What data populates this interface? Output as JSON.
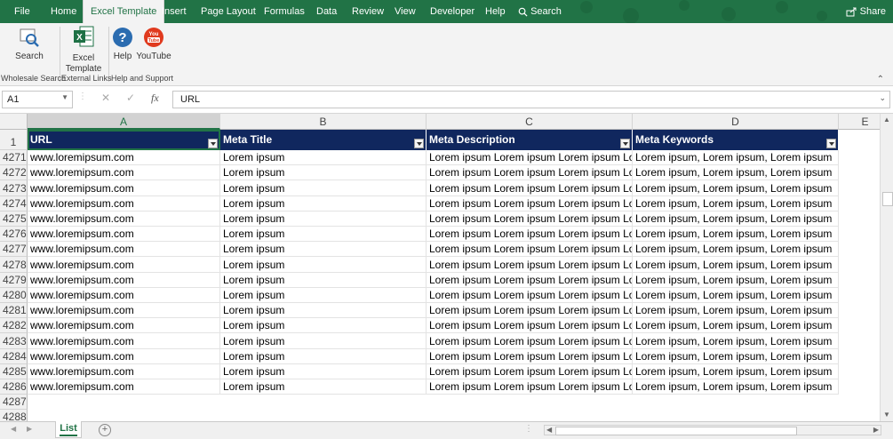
{
  "ribbon_tabs": [
    "File",
    "Home",
    "Excel Template",
    "Insert",
    "Page Layout",
    "Formulas",
    "Data",
    "Review",
    "View",
    "Developer",
    "Help"
  ],
  "tell_me": "Search",
  "share_label": "Share",
  "ribbon_buttons": {
    "search": "Search",
    "excel_template_line1": "Excel",
    "excel_template_line2": "Template",
    "help": "Help",
    "youtube": "YouTube"
  },
  "ribbon_groups": {
    "wholesale_search": "Wholesale Search",
    "external_links": "External Links",
    "help_support": "Help and Support"
  },
  "icons": {
    "youtube_line1": "You",
    "youtube_line2": "Tube"
  },
  "name_box": "A1",
  "formula_value": "URL",
  "columns": [
    "A",
    "B",
    "C",
    "D",
    "E"
  ],
  "header_row_number": "1",
  "table_headers": [
    "URL",
    "Meta Title",
    "Meta Description",
    "Meta Keywords"
  ],
  "rows": [
    {
      "num": "4271",
      "url": "www.loremipsum.com",
      "title": "Lorem ipsum",
      "desc": "Lorem ipsum Lorem ipsum Lorem ipsum Lo",
      "kw": "Lorem ipsum, Lorem ipsum, Lorem ipsum"
    },
    {
      "num": "4272",
      "url": "www.loremipsum.com",
      "title": "Lorem ipsum",
      "desc": "Lorem ipsum Lorem ipsum Lorem ipsum Lo",
      "kw": "Lorem ipsum, Lorem ipsum, Lorem ipsum"
    },
    {
      "num": "4273",
      "url": "www.loremipsum.com",
      "title": "Lorem ipsum",
      "desc": "Lorem ipsum Lorem ipsum Lorem ipsum Lo",
      "kw": "Lorem ipsum, Lorem ipsum, Lorem ipsum"
    },
    {
      "num": "4274",
      "url": "www.loremipsum.com",
      "title": "Lorem ipsum",
      "desc": "Lorem ipsum Lorem ipsum Lorem ipsum Lo",
      "kw": "Lorem ipsum, Lorem ipsum, Lorem ipsum"
    },
    {
      "num": "4275",
      "url": "www.loremipsum.com",
      "title": "Lorem ipsum",
      "desc": "Lorem ipsum Lorem ipsum Lorem ipsum Lo",
      "kw": "Lorem ipsum, Lorem ipsum, Lorem ipsum"
    },
    {
      "num": "4276",
      "url": "www.loremipsum.com",
      "title": "Lorem ipsum",
      "desc": "Lorem ipsum Lorem ipsum Lorem ipsum Lo",
      "kw": "Lorem ipsum, Lorem ipsum, Lorem ipsum"
    },
    {
      "num": "4277",
      "url": "www.loremipsum.com",
      "title": "Lorem ipsum",
      "desc": "Lorem ipsum Lorem ipsum Lorem ipsum Lo",
      "kw": "Lorem ipsum, Lorem ipsum, Lorem ipsum"
    },
    {
      "num": "4278",
      "url": "www.loremipsum.com",
      "title": "Lorem ipsum",
      "desc": "Lorem ipsum Lorem ipsum Lorem ipsum Lo",
      "kw": "Lorem ipsum, Lorem ipsum, Lorem ipsum"
    },
    {
      "num": "4279",
      "url": "www.loremipsum.com",
      "title": "Lorem ipsum",
      "desc": "Lorem ipsum Lorem ipsum Lorem ipsum Lo",
      "kw": "Lorem ipsum, Lorem ipsum, Lorem ipsum"
    },
    {
      "num": "4280",
      "url": "www.loremipsum.com",
      "title": "Lorem ipsum",
      "desc": "Lorem ipsum Lorem ipsum Lorem ipsum Lo",
      "kw": "Lorem ipsum, Lorem ipsum, Lorem ipsum"
    },
    {
      "num": "4281",
      "url": "www.loremipsum.com",
      "title": "Lorem ipsum",
      "desc": "Lorem ipsum Lorem ipsum Lorem ipsum Lo",
      "kw": "Lorem ipsum, Lorem ipsum, Lorem ipsum"
    },
    {
      "num": "4282",
      "url": "www.loremipsum.com",
      "title": "Lorem ipsum",
      "desc": "Lorem ipsum Lorem ipsum Lorem ipsum Lo",
      "kw": "Lorem ipsum, Lorem ipsum, Lorem ipsum"
    },
    {
      "num": "4283",
      "url": "www.loremipsum.com",
      "title": "Lorem ipsum",
      "desc": "Lorem ipsum Lorem ipsum Lorem ipsum Lo",
      "kw": "Lorem ipsum, Lorem ipsum, Lorem ipsum"
    },
    {
      "num": "4284",
      "url": "www.loremipsum.com",
      "title": "Lorem ipsum",
      "desc": "Lorem ipsum Lorem ipsum Lorem ipsum Lo",
      "kw": "Lorem ipsum, Lorem ipsum, Lorem ipsum"
    },
    {
      "num": "4285",
      "url": "www.loremipsum.com",
      "title": "Lorem ipsum",
      "desc": "Lorem ipsum Lorem ipsum Lorem ipsum Lo",
      "kw": "Lorem ipsum, Lorem ipsum, Lorem ipsum"
    },
    {
      "num": "4286",
      "url": "www.loremipsum.com",
      "title": "Lorem ipsum",
      "desc": "Lorem ipsum Lorem ipsum Lorem ipsum Lo",
      "kw": "Lorem ipsum, Lorem ipsum, Lorem ipsum"
    }
  ],
  "empty_rows": [
    "4287",
    "4288"
  ],
  "sheet_tab": "List",
  "colors": {
    "accent": "#217346",
    "table_header_bg": "#10275e"
  }
}
